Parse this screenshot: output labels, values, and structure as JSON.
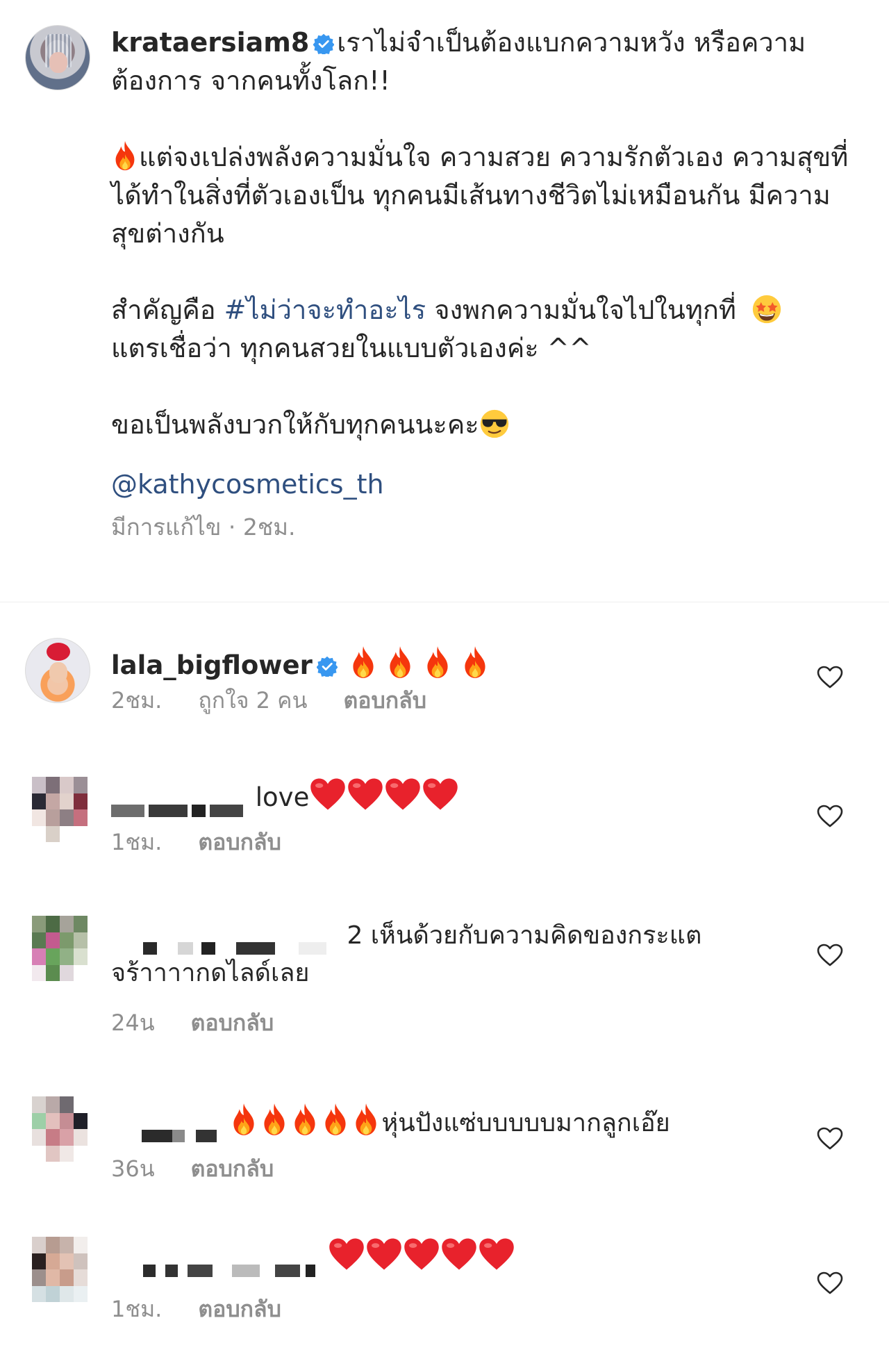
{
  "post": {
    "username": "krataersiam8",
    "caption_line1": "เราไม่จำเป็นต้องแบกความหวัง หรือความต้องการ จากคนทั้งโลก!!",
    "caption_para2": "แต่จงเปล่งพลังความมั่นใจ ความสวย ความรักตัวเอง ความสุขที่ได้ทำในสิ่งที่ตัวเองเป็น ทุกคนมีเส้นทางชีวิตไม่เหมือนกัน มีความสุขต่างกัน",
    "caption_para3_prefix": "สำคัญคือ ",
    "hashtag": "#ไม่ว่าจะทำอะไร",
    "caption_para3_suffix": " จงพกความมั่นใจไปในทุกที่",
    "caption_para3_line2": "แตรเชื่อว่า ทุกคนสวยในแบบตัวเองค่ะ ^^",
    "caption_para4": "ขอเป็นพลังบวกให้กับทุกคนนะคะ",
    "mention": "@kathycosmetics_th",
    "edited_label": "มีการแก้ไข",
    "separator": " · ",
    "time_ago": "2ชม."
  },
  "comments": [
    {
      "username": "lala_bigflower",
      "text": "",
      "time": "2ชม.",
      "likes": "ถูกใจ 2 คน",
      "reply": "ตอบกลับ"
    },
    {
      "username": "",
      "text": "love",
      "time": "1ชม.",
      "reply": "ตอบกลับ"
    },
    {
      "username": "",
      "text_part1": "2 เห็นด้วยกับความคิดของกระแต",
      "text_part2": "จร้าาาากดไลด์เลย",
      "time": "24น",
      "reply": "ตอบกลับ"
    },
    {
      "username": "",
      "text": "หุ่นปังแซ่บบบบบมากลูกเอ๊ย",
      "time": "36น",
      "reply": "ตอบกลับ"
    },
    {
      "username": "",
      "text": "",
      "time": "1ชม.",
      "reply": "ตอบกลับ"
    }
  ],
  "icons": {
    "verified": "verified-badge-icon",
    "heart": "heart-outline-icon",
    "fire": "fire-emoji",
    "red_heart": "red-heart-emoji",
    "star_struck": "star-struck-emoji",
    "sunglasses": "sunglasses-emoji"
  },
  "colors": {
    "link": "#2f4f7f",
    "verified": "#3897f0",
    "meta": "#8e8e8e"
  }
}
